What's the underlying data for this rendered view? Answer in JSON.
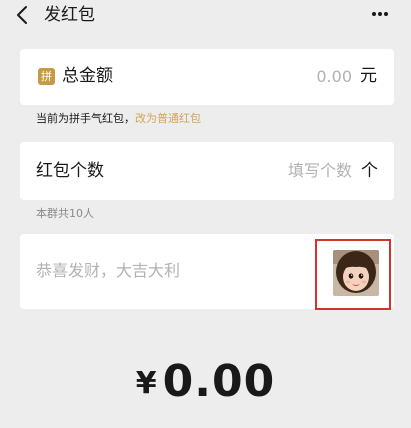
{
  "nav": {
    "title": "发红包",
    "back_icon": "chevron-left-icon",
    "more_icon": "more-horizontal-icon"
  },
  "amount_card": {
    "badge": "拼",
    "label": "总金额",
    "value": "0.00",
    "unit": "元"
  },
  "mode_hint": {
    "text": "当前为拼手气红包，",
    "link": "改为普通红包"
  },
  "count_card": {
    "label": "红包个数",
    "placeholder": "填写个数",
    "unit": "个"
  },
  "group_hint": "本群共10人",
  "greeting": {
    "placeholder": "恭喜发财，大吉大利"
  },
  "cover_icon": "red-packet-cover-photo",
  "total": {
    "currency": "¥",
    "amount": "0.00"
  },
  "colors": {
    "background": "#ededed",
    "card": "#ffffff",
    "badge": "#c59a45",
    "link": "#d2a45b",
    "highlight_border": "#d0342c",
    "placeholder": "#b2b2b2"
  }
}
